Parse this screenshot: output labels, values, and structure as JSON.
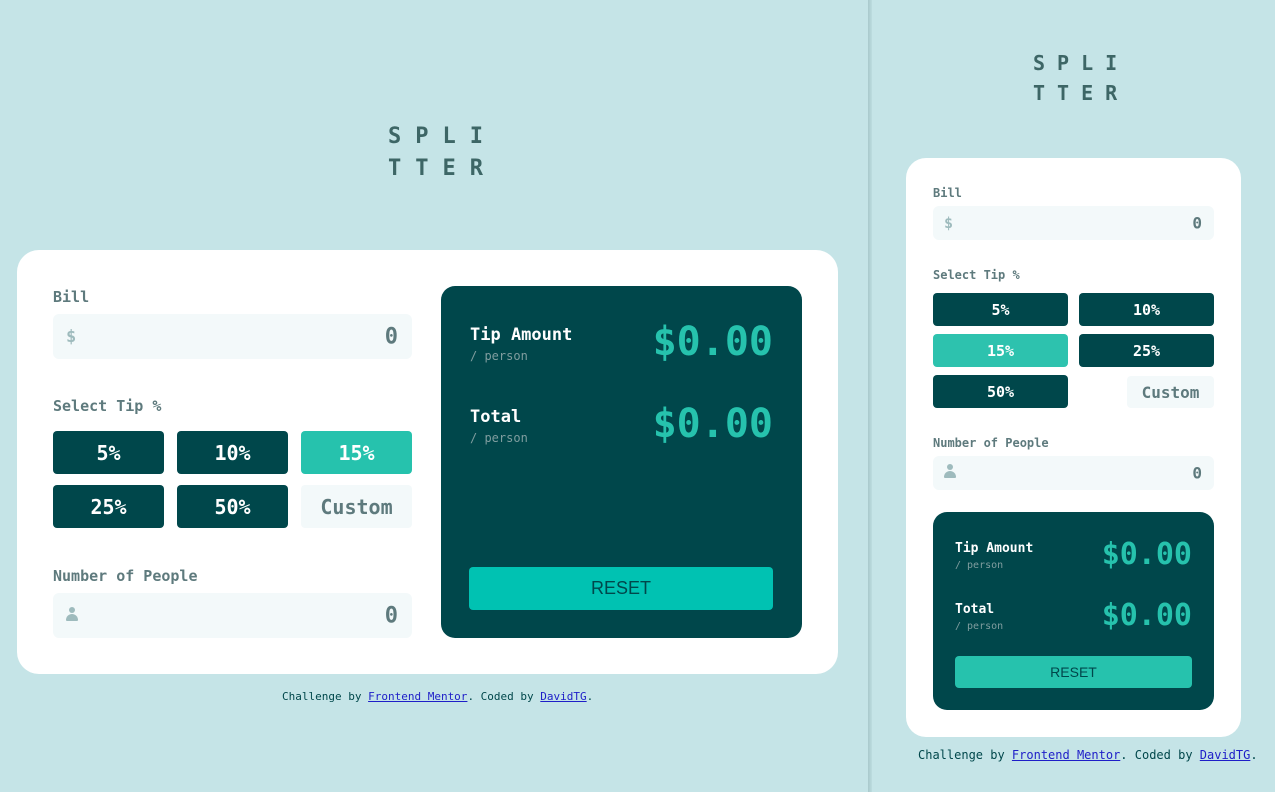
{
  "app": {
    "logo_line1": "SPLI",
    "logo_line2": "TTER"
  },
  "form": {
    "bill_label": "Bill",
    "bill_currency": "$",
    "bill_value": "0",
    "tip_label": "Select Tip %",
    "tips": [
      "5%",
      "10%",
      "15%",
      "25%",
      "50%"
    ],
    "active_tip": "15%",
    "custom_placeholder": "Custom",
    "people_label": "Number of People",
    "people_value": "0"
  },
  "result": {
    "tip_label": "Tip Amount",
    "tip_sub": "/ person",
    "tip_value": "$0.00",
    "total_label": "Total",
    "total_sub": "/ person",
    "total_value": "$0.00",
    "reset_label": "RESET"
  },
  "footer": {
    "prefix": "Challenge by ",
    "link1": "Frontend Mentor",
    "middle": ". Coded by ",
    "link2": "DavidTG",
    "suffix": "."
  },
  "colors": {
    "page_bg": "#c5e4e7",
    "dark_teal": "#00474b",
    "accent": "#26c2ad",
    "field_bg": "#f3f9fa"
  }
}
